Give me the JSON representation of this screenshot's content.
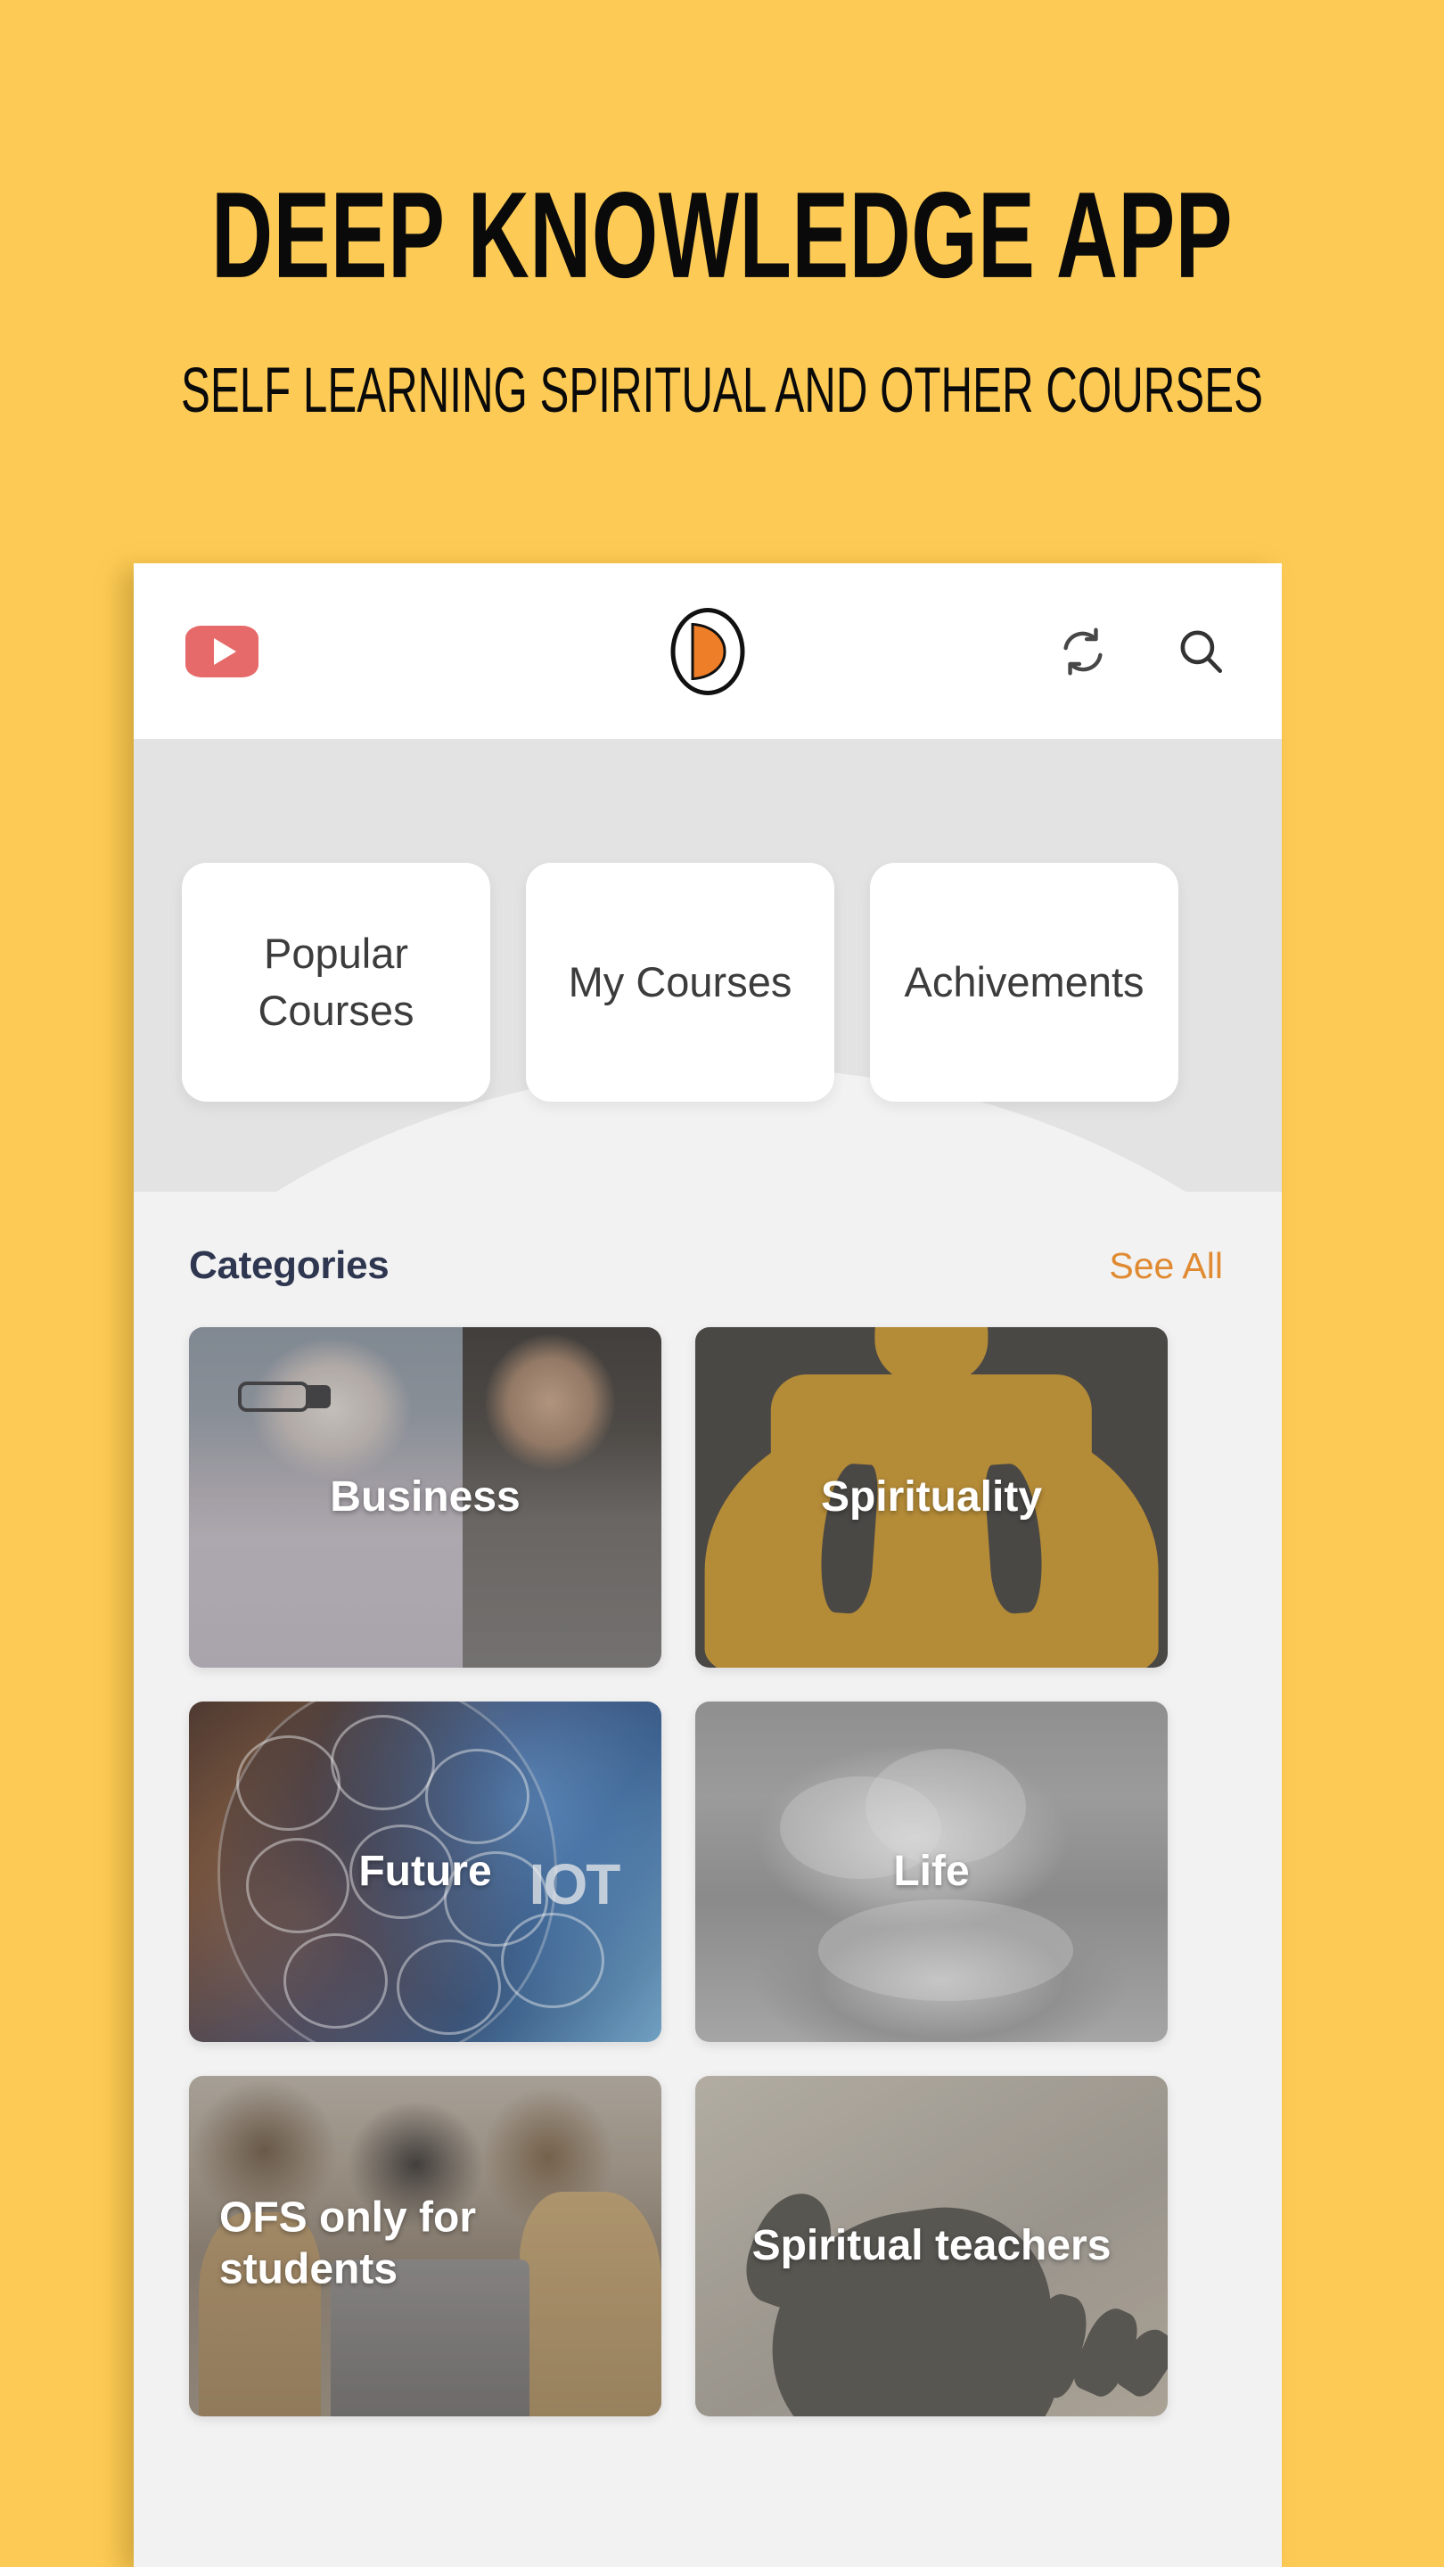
{
  "promo": {
    "title": "DEEP KNOWLEDGE APP",
    "subtitle": "SELF LEARNING SPIRITUAL AND OTHER COURSES",
    "background_color": "#FDCB55"
  },
  "appbar": {
    "youtube_icon": "youtube-icon",
    "brand_logo": "deep-knowledge-logo",
    "sync_icon": "sync-icon",
    "search_icon": "search-icon",
    "accent_color": "#EF7E29"
  },
  "tabs": [
    {
      "label": "Popular Courses"
    },
    {
      "label": "My Courses"
    },
    {
      "label": "Achivements"
    }
  ],
  "section": {
    "title": "Categories",
    "see_all_label": "See All",
    "see_all_color": "#E08A32",
    "title_color": "#2E3650"
  },
  "categories": [
    {
      "label": "Business",
      "align": "center"
    },
    {
      "label": "Spirituality",
      "align": "center"
    },
    {
      "label": "Future",
      "align": "center"
    },
    {
      "label": "Life",
      "align": "center"
    },
    {
      "label": "OFS only for students",
      "align": "left"
    },
    {
      "label": "Spiritual teachers",
      "align": "center"
    }
  ]
}
